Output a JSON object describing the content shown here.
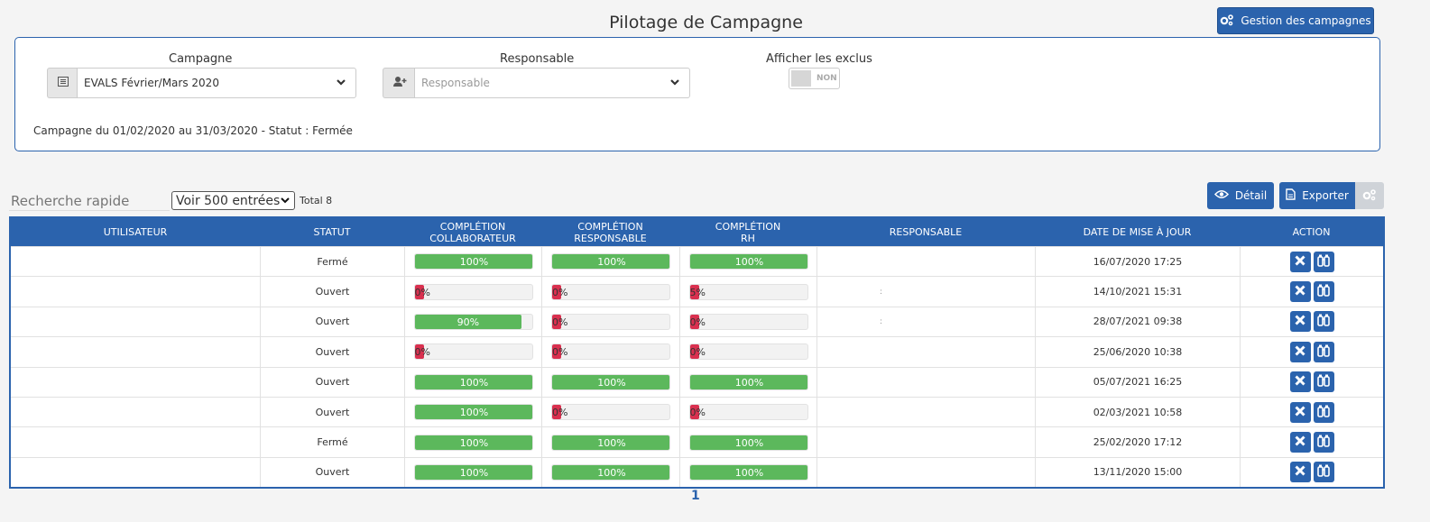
{
  "header": {
    "title": "Pilotage de Campagne",
    "gestion_button": "Gestion des campagnes"
  },
  "filters": {
    "campagne_label": "Campagne",
    "campagne_value": "EVALS Février/Mars 2020",
    "responsable_label": "Responsable",
    "responsable_placeholder": "Responsable",
    "exclus_label": "Afficher les exclus",
    "exclus_toggle": "NON",
    "campaign_info": "Campagne du 01/02/2020 au 31/03/2020 - Statut : Fermée"
  },
  "toolbar": {
    "search_placeholder": "Recherche rapide",
    "length_label": "Voir 500 entrées",
    "total": "Total 8",
    "detail_button": "Détail",
    "export_button": "Exporter"
  },
  "table": {
    "columns": [
      "UTILISATEUR",
      "STATUT",
      "COMPLÉTION COLLABORATEUR",
      "COMPLÉTION RESPONSABLE",
      "COMPLÉTION RH",
      "RESPONSABLE",
      "DATE DE MISE À JOUR",
      "ACTION"
    ],
    "rows": [
      {
        "utilisateur": "",
        "statut": "Fermé",
        "collab": "100%",
        "collab_pct": 100,
        "resp": "100%",
        "resp_pct": 100,
        "rh": "100%",
        "rh_pct": 100,
        "responsable": "",
        "date": "16/07/2020 17:25"
      },
      {
        "utilisateur": "",
        "statut": "Ouvert",
        "collab": "0%",
        "collab_pct": 0,
        "resp": "0%",
        "resp_pct": 0,
        "rh": "5%",
        "rh_pct": 5,
        "responsable": ":",
        "date": "14/10/2021 15:31"
      },
      {
        "utilisateur": "",
        "statut": "Ouvert",
        "collab": "90%",
        "collab_pct": 90,
        "resp": "0%",
        "resp_pct": 0,
        "rh": "0%",
        "rh_pct": 0,
        "responsable": ":",
        "date": "28/07/2021 09:38"
      },
      {
        "utilisateur": "",
        "statut": "Ouvert",
        "collab": "0%",
        "collab_pct": 0,
        "resp": "0%",
        "resp_pct": 0,
        "rh": "0%",
        "rh_pct": 0,
        "responsable": "",
        "date": "25/06/2020 10:38"
      },
      {
        "utilisateur": "",
        "statut": "Ouvert",
        "collab": "100%",
        "collab_pct": 100,
        "resp": "100%",
        "resp_pct": 100,
        "rh": "100%",
        "rh_pct": 100,
        "responsable": "",
        "date": "05/07/2021 16:25"
      },
      {
        "utilisateur": "",
        "statut": "Ouvert",
        "collab": "100%",
        "collab_pct": 100,
        "resp": "0%",
        "resp_pct": 0,
        "rh": "0%",
        "rh_pct": 0,
        "responsable": "",
        "date": "02/03/2021 10:58"
      },
      {
        "utilisateur": "",
        "statut": "Fermé",
        "collab": "100%",
        "collab_pct": 100,
        "resp": "100%",
        "resp_pct": 100,
        "rh": "100%",
        "rh_pct": 100,
        "responsable": "",
        "date": "25/02/2020 17:12"
      },
      {
        "utilisateur": "",
        "statut": "Ouvert",
        "collab": "100%",
        "collab_pct": 100,
        "resp": "100%",
        "resp_pct": 100,
        "rh": "100%",
        "rh_pct": 100,
        "responsable": "",
        "date": "13/11/2020 15:00"
      }
    ]
  },
  "pagination": {
    "current": "1"
  },
  "colors": {
    "primary": "#2b63ad",
    "success": "#5cb85c",
    "danger": "#d9304f"
  },
  "icons": {
    "gestion": "gears-icon",
    "campagne_addon": "list-icon",
    "responsable_addon": "user-plus-icon",
    "detail": "eye-icon",
    "export": "file-export-icon",
    "settings": "gears-icon",
    "action_delete": "close-icon",
    "action_view": "binoculars-icon"
  }
}
